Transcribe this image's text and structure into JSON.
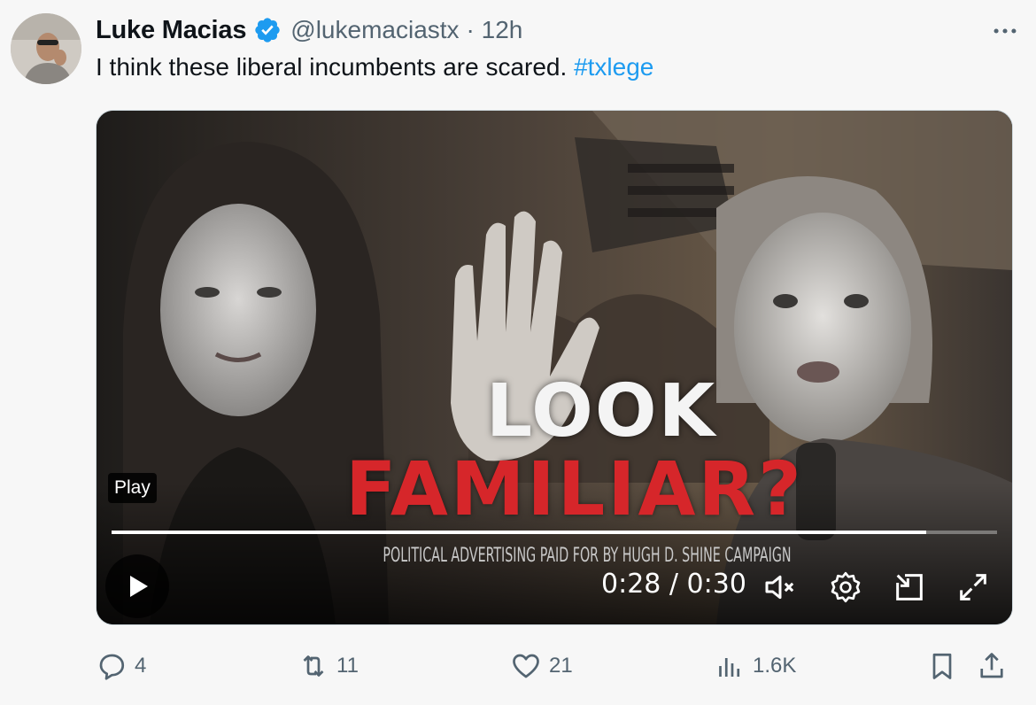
{
  "author": {
    "name": "Luke Macias",
    "handle": "@lukemaciastx",
    "time": "· 12h",
    "verified": true
  },
  "tweet": {
    "text": "I think these liberal incumbents are scared. ",
    "hashtag": "#txlege"
  },
  "video": {
    "overlay_line1": "LOOK",
    "overlay_line2": "FAMILIAR?",
    "disclaimer": "POLITICAL ADVERTISING PAID FOR BY HUGH D. SHINE CAMPAIGN",
    "tooltip": "Play",
    "time_display": "0:28 / 0:30",
    "progress_fraction": 0.92
  },
  "actions": {
    "replies": "4",
    "reposts": "11",
    "likes": "21",
    "views": "1.6K"
  },
  "colors": {
    "accent": "#1d9bf0",
    "muted": "#536471",
    "overlay_red": "#d6262a"
  },
  "icons": [
    "verified-badge-icon",
    "more-icon",
    "play-icon",
    "mute-icon",
    "settings-icon",
    "pip-icon",
    "fullscreen-icon",
    "reply-icon",
    "repost-icon",
    "like-icon",
    "views-icon",
    "bookmark-icon",
    "share-icon"
  ]
}
